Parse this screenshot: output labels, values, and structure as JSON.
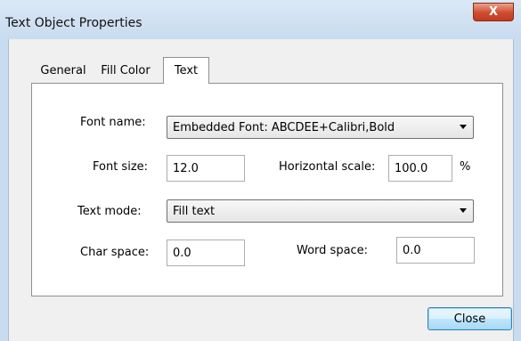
{
  "window": {
    "title": "Text Object Properties",
    "close_glyph": "X"
  },
  "tabs": [
    {
      "label": "General"
    },
    {
      "label": "Fill Color"
    },
    {
      "label": "Text",
      "selected": true
    }
  ],
  "text_tab": {
    "font_name": {
      "label": "Font name:",
      "value": "Embedded Font: ABCDEE+Calibri,Bold"
    },
    "font_size": {
      "label": "Font size:",
      "value": "12.0"
    },
    "horizontal_scale": {
      "label": "Horizontal scale:",
      "value": "100.0",
      "unit": "%"
    },
    "text_mode": {
      "label": "Text mode:",
      "value": "Fill text"
    },
    "char_space": {
      "label": "Char space:",
      "value": "0.0"
    },
    "word_space": {
      "label": "Word space:",
      "value": "0.0"
    }
  },
  "buttons": {
    "close": "Close"
  },
  "icons": {
    "window_close": "close-icon",
    "dropdown": "chevron-down-icon"
  },
  "colors": {
    "title_bar": "#c8dbef",
    "close_button_red": "#cf4c2f",
    "dialog_button_border": "#3c7fb1",
    "panel_background": "#ffffff",
    "dialog_background": "#f0f0f0"
  }
}
